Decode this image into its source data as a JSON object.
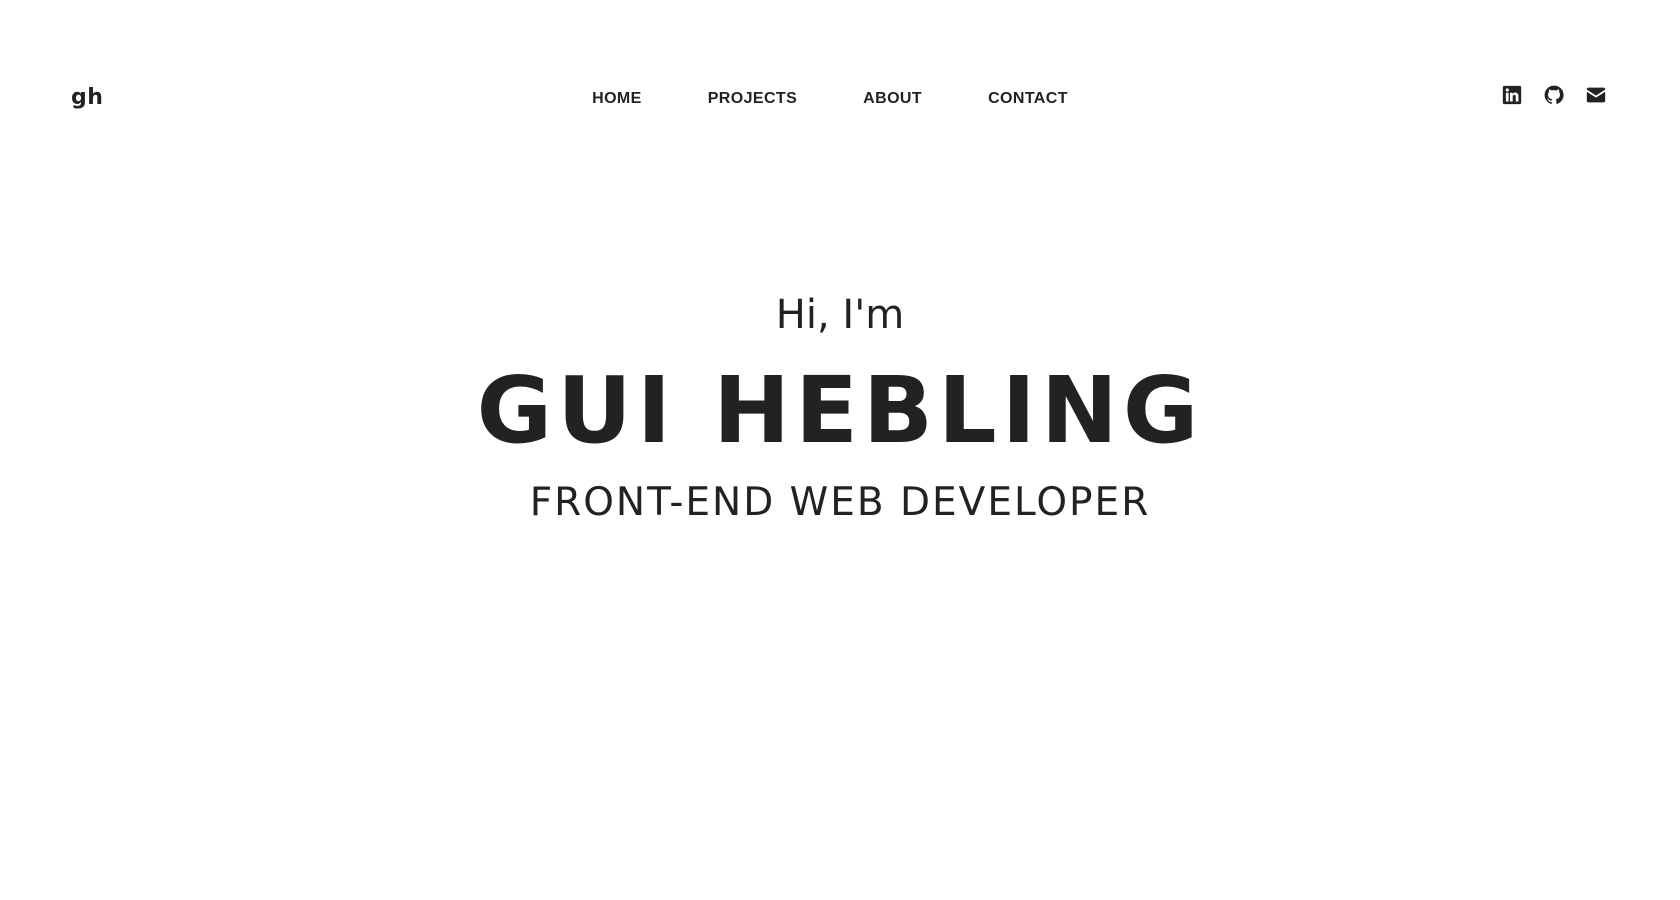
{
  "header": {
    "logo": "gh",
    "nav": [
      {
        "label": "HOME"
      },
      {
        "label": "PROJECTS"
      },
      {
        "label": "ABOUT"
      },
      {
        "label": "CONTACT"
      }
    ],
    "social": [
      {
        "icon": "linkedin-icon"
      },
      {
        "icon": "github-icon"
      },
      {
        "icon": "envelope-icon"
      }
    ]
  },
  "hero": {
    "greeting": "Hi, I'm",
    "name": "GUI HEBLING",
    "role": "FRONT-END WEB DEVELOPER"
  },
  "colors": {
    "text": "#222222",
    "background": "#ffffff"
  }
}
